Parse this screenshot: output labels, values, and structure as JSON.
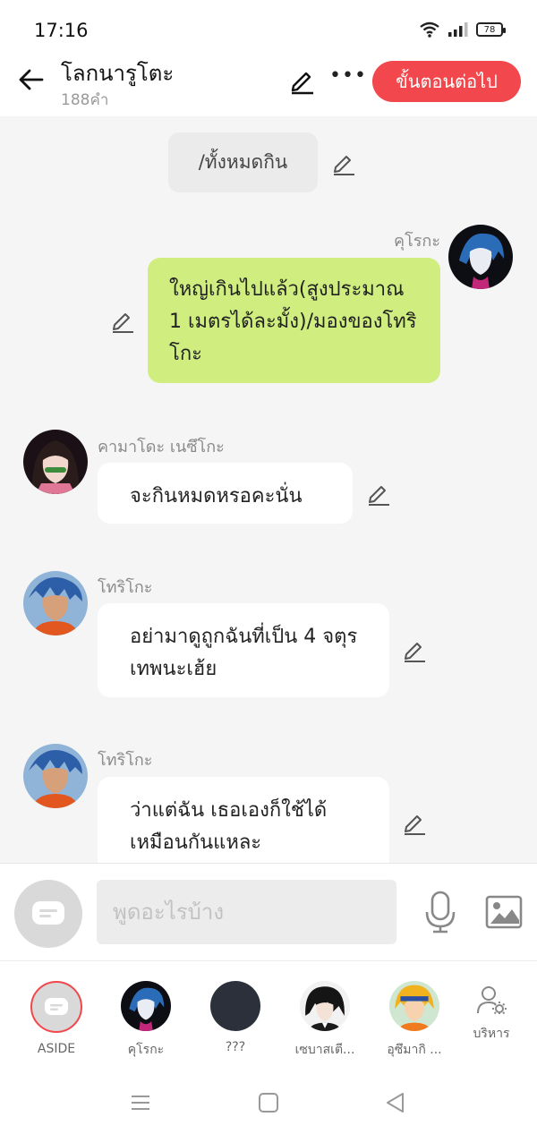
{
  "status_bar": {
    "time": "17:16",
    "battery": "78"
  },
  "header": {
    "title": "โลกนารูโตะ",
    "word_count": "188คำ",
    "next_button": "ขั้นตอนต่อไป",
    "more_label": "•••"
  },
  "chat": {
    "system_message": "/ทั้งหมดกิน",
    "messages": [
      {
        "sender": "คุโรกะ",
        "text": "ใหญ่เกินไปแล้ว(สูงประมาณ 1 เมตรได้ละมั้ง)/มองของโทริโกะ",
        "side": "right"
      },
      {
        "sender": "คามาโดะ เนซึโกะ",
        "text": "จะกินหมดหรอคะนั่น",
        "side": "left"
      },
      {
        "sender": "โทริโกะ",
        "text": "อย่ามาดูถูกฉันที่เป็น 4 จตุรเทพนะเฮ้ย",
        "side": "left"
      },
      {
        "sender": "โทริโกะ",
        "text": "ว่าแต่ฉัน เธอเองก็ใช้ได้เหมือนกันแหละ",
        "side": "left"
      }
    ]
  },
  "input": {
    "placeholder": "พูดอะไรบ้าง"
  },
  "characters": [
    {
      "label": "ASIDE"
    },
    {
      "label": "คุโรกะ"
    },
    {
      "label": "???"
    },
    {
      "label": "เซบาสเตี..."
    },
    {
      "label": "อุซึมากิ ..."
    },
    {
      "label": "บริหาร"
    }
  ],
  "colors": {
    "accent": "#f2474c",
    "my_bubble": "#cfee7f",
    "background": "#f5f5f5"
  }
}
